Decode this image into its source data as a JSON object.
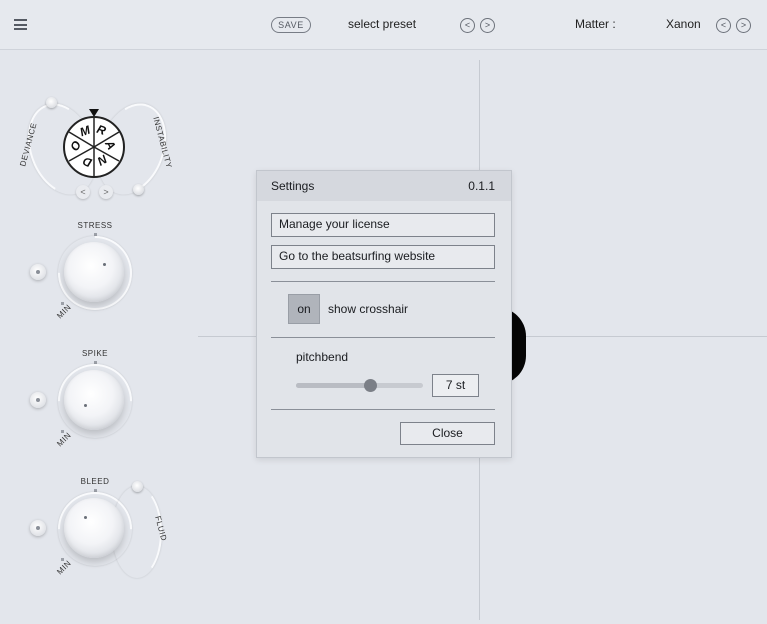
{
  "topbar": {
    "save_label": "SAVE",
    "preset_label": "select preset",
    "prev_glyph": "<",
    "next_glyph": ">",
    "matter_label": "Matter :",
    "matter_value": "Xanon"
  },
  "left_panel": {
    "wheel_letters": [
      "R",
      "A",
      "N",
      "D",
      "O",
      "M"
    ],
    "deviance_label": "DEVIANCE",
    "instability_label": "INSTABILITY",
    "stress_label": "STRESS",
    "spike_label": "SPIKE",
    "bleed_label": "BLEED",
    "fluid_label": "FLUID",
    "min_label": "MIN"
  },
  "settings": {
    "title": "Settings",
    "version": "0.1.1",
    "manage_license": "Manage your license",
    "website": "Go to the beatsurfing website",
    "crosshair_toggle": "on",
    "crosshair_label": "show crosshair",
    "pitchbend_label": "pitchbend",
    "pitchbend_fraction": 0.6,
    "pitchbend_value": "7 st",
    "close_label": "Close"
  },
  "colors": {
    "background": "#e3e6ec",
    "dialog_bg": "#e1e4e9",
    "toggle_on_bg": "#b0b4bb"
  },
  "icons": {
    "menu": "hamburger-icon",
    "prev": "chevron-left-icon",
    "next": "chevron-right-icon"
  }
}
